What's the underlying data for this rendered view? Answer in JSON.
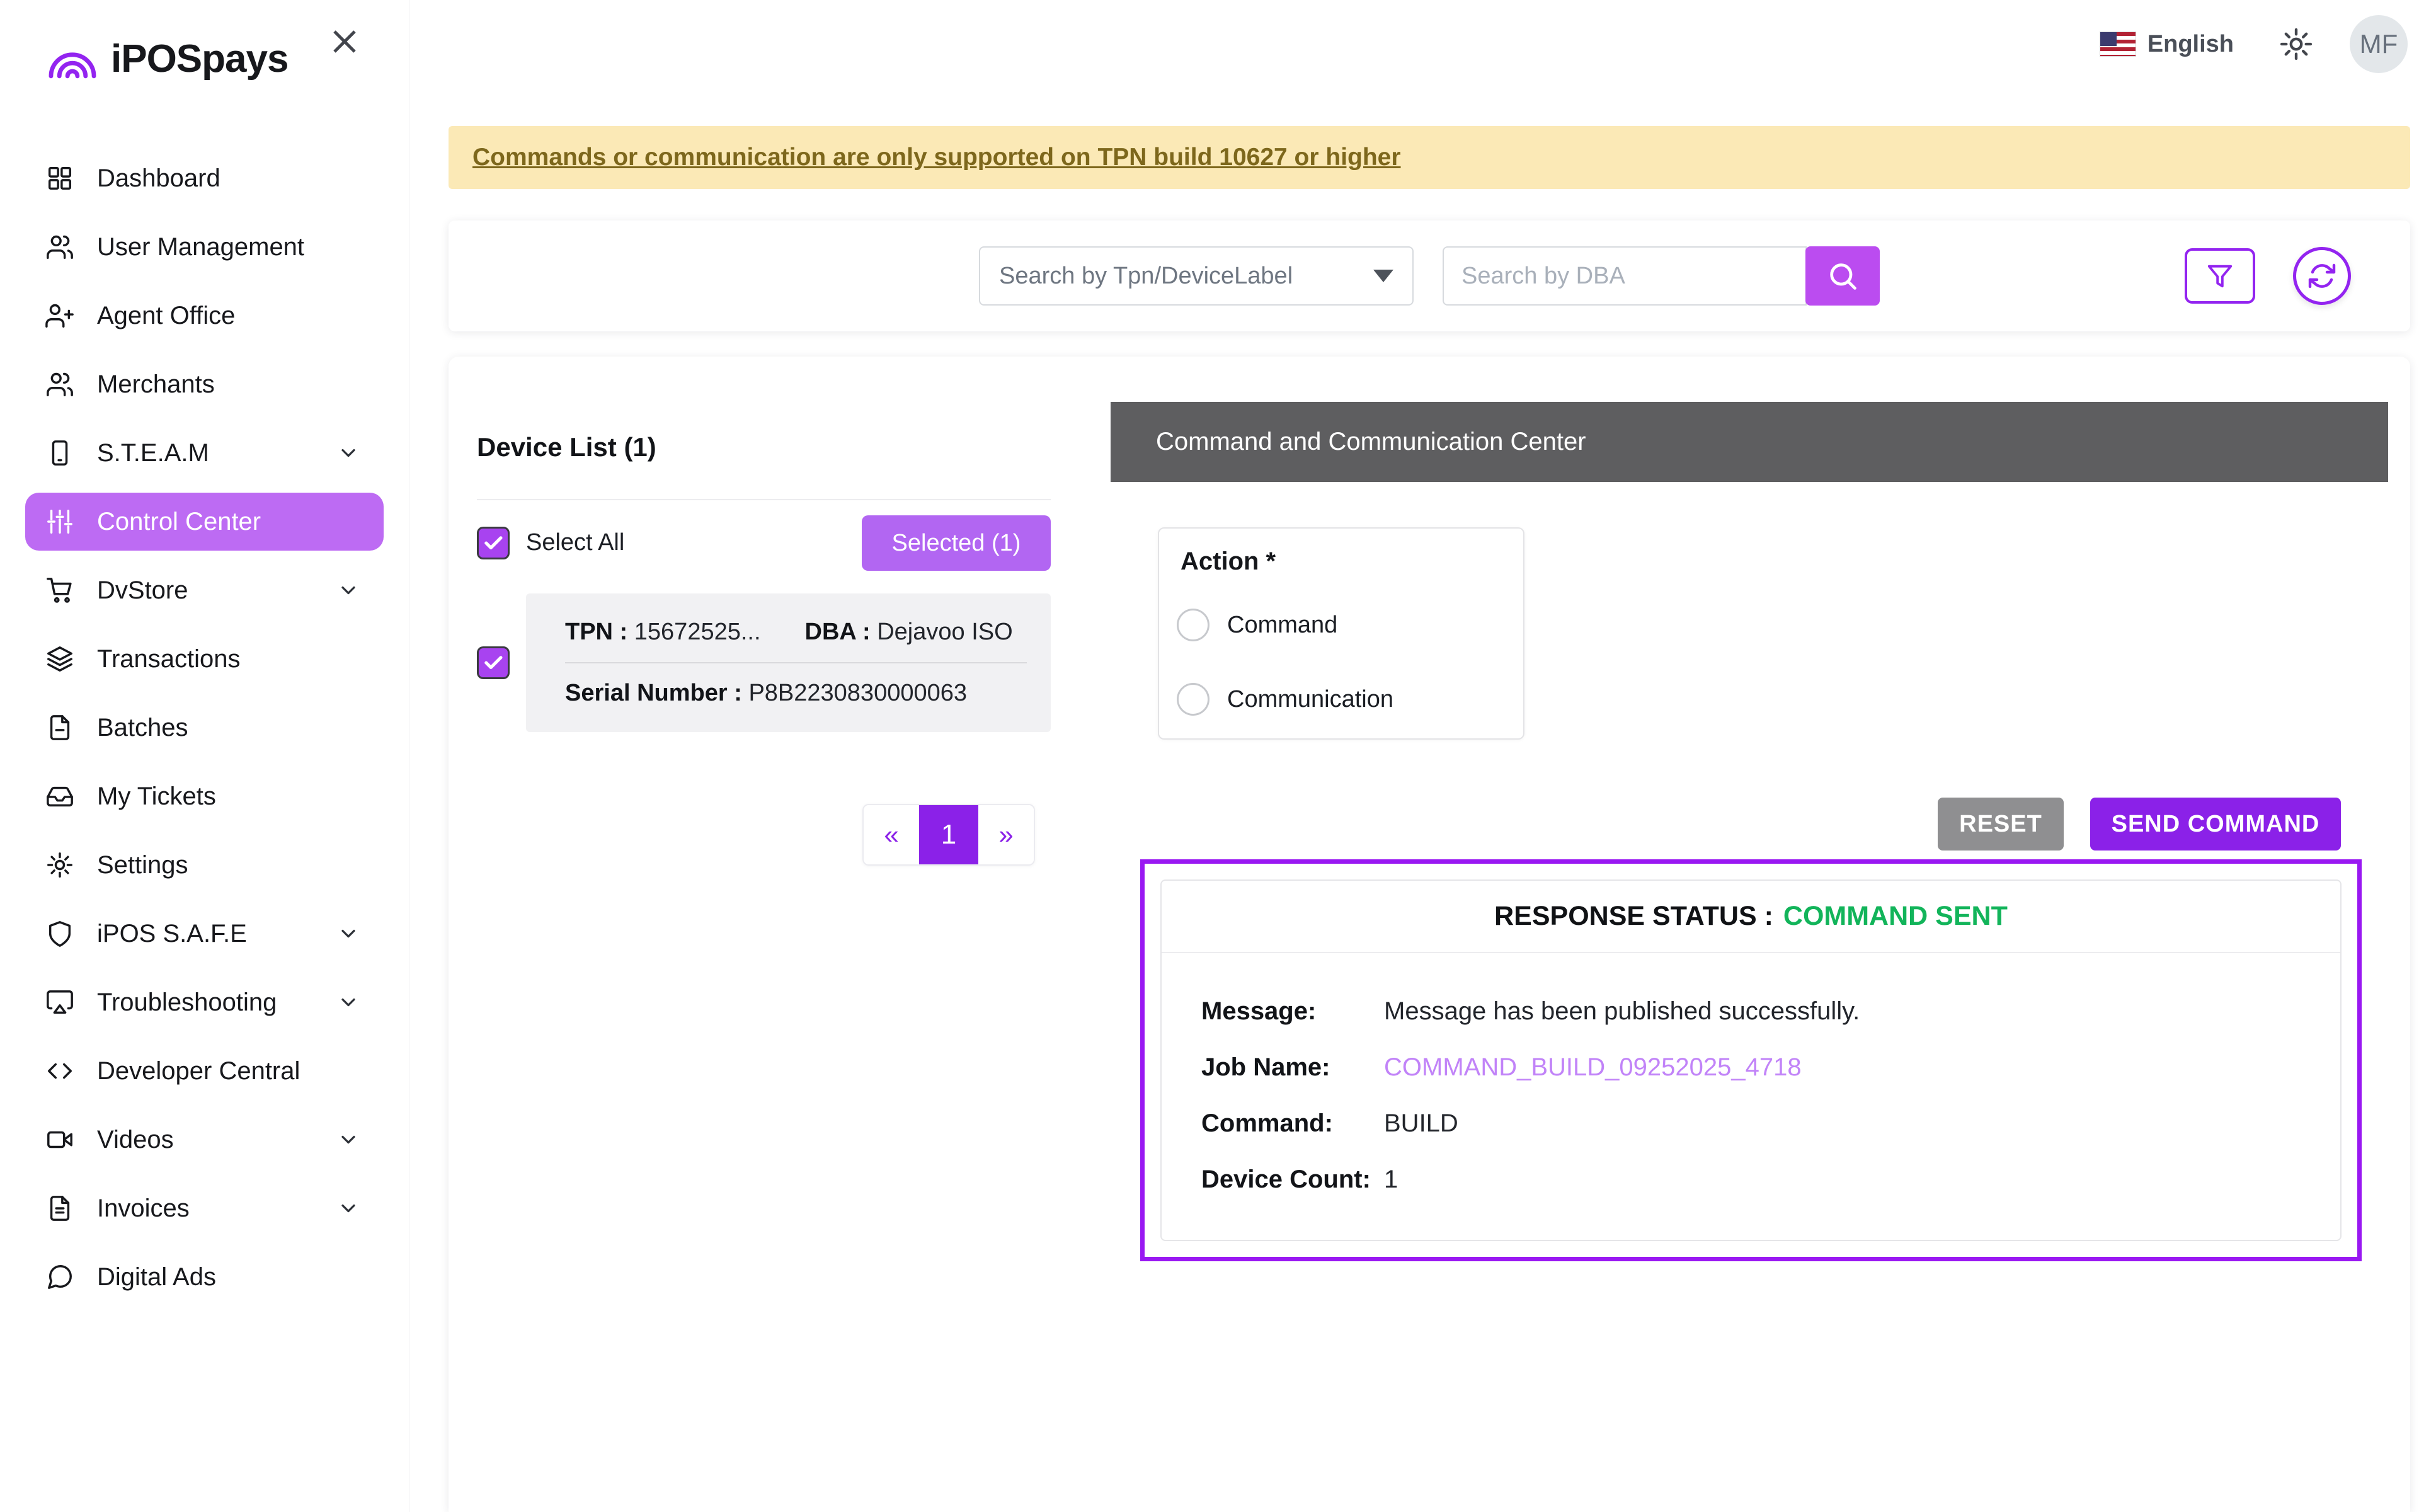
{
  "brand": {
    "name": "iPOSpays"
  },
  "topbar": {
    "language": "English",
    "avatar_initials": "MF"
  },
  "sidebar": {
    "items": [
      {
        "label": "Dashboard"
      },
      {
        "label": "User Management"
      },
      {
        "label": "Agent Office"
      },
      {
        "label": "Merchants"
      },
      {
        "label": "S.T.E.A.M"
      },
      {
        "label": "Control Center"
      },
      {
        "label": "DvStore"
      },
      {
        "label": "Transactions"
      },
      {
        "label": "Batches"
      },
      {
        "label": "My Tickets"
      },
      {
        "label": "Settings"
      },
      {
        "label": "iPOS S.A.F.E"
      },
      {
        "label": "Troubleshooting"
      },
      {
        "label": "Developer Central"
      },
      {
        "label": "Videos"
      },
      {
        "label": "Invoices"
      },
      {
        "label": "Digital Ads"
      }
    ]
  },
  "banner": {
    "text": "Commands or communication are only supported on TPN build 10627 or higher"
  },
  "toolbar": {
    "search_type_value": "Search by Tpn/DeviceLabel",
    "dba_placeholder": "Search by DBA"
  },
  "device_list": {
    "title": "Device List (1)",
    "select_all_label": "Select All",
    "selected_button": "Selected (1)",
    "device": {
      "tpn_label": "TPN :",
      "tpn": "15672525...",
      "dba_label": "DBA :",
      "dba": "Dejavoo ISO",
      "serial_label": "Serial Number :",
      "serial": "P8B2230830000063"
    },
    "pagination": {
      "prev": "«",
      "page": "1",
      "next": "»"
    }
  },
  "command_center": {
    "title": "Command and Communication Center",
    "action_label": "Action *",
    "options": [
      {
        "label": "Command"
      },
      {
        "label": "Communication"
      }
    ],
    "reset_button": "RESET",
    "send_button": "SEND COMMAND",
    "response": {
      "status_label": "RESPONSE STATUS :",
      "status_value": "COMMAND SENT",
      "rows": [
        {
          "label": "Message:",
          "value": "Message has been published successfully."
        },
        {
          "label": "Job Name:",
          "value": "COMMAND_BUILD_09252025_4718"
        },
        {
          "label": "Command:",
          "value": "BUILD"
        },
        {
          "label": "Device Count:",
          "value": "1"
        }
      ]
    }
  },
  "colors": {
    "accent_purple": "#9324f0",
    "vivid_purple": "#8b21e8",
    "light_purple": "#bd6bf3",
    "link_purple": "#c183f8",
    "success_green": "#12b45a",
    "banner_bg": "#fbe9b6",
    "banner_text": "#7d671c",
    "header_gray": "#5e5e60",
    "reset_gray": "#8f8f91"
  }
}
